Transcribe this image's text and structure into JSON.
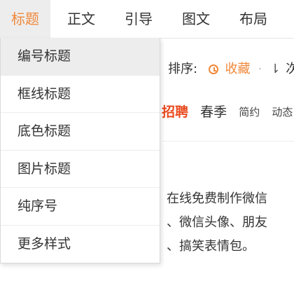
{
  "topbar": {
    "tabs": [
      {
        "label": "标题",
        "active": true
      },
      {
        "label": "正文",
        "active": false
      },
      {
        "label": "引导",
        "active": false
      },
      {
        "label": "图文",
        "active": false
      },
      {
        "label": "布局",
        "active": false
      }
    ]
  },
  "dropdown": {
    "items": [
      {
        "label": "编号标题",
        "highlighted": true
      },
      {
        "label": "框线标题",
        "highlighted": false
      },
      {
        "label": "底色标题",
        "highlighted": false
      },
      {
        "label": "图片标题",
        "highlighted": false
      },
      {
        "label": "纯序号",
        "highlighted": false
      },
      {
        "label": "更多样式",
        "highlighted": false
      }
    ]
  },
  "background": {
    "sort": {
      "label": "排序:",
      "collect_label": "收藏",
      "separator": "·",
      "order_label": "次"
    },
    "tags": [
      {
        "label": "招聘"
      },
      {
        "label": "春季"
      },
      {
        "label": "简约"
      },
      {
        "label": "动态"
      }
    ],
    "description_lines": [
      "在线免费制作微信",
      "、微信头像、朋友",
      "、搞笑表情包。"
    ]
  },
  "colors": {
    "accent": "#f0883a",
    "hot_tag": "#e94a1f",
    "active_tab_bg": "#ededed",
    "menu_hover_bg": "#ededed"
  }
}
